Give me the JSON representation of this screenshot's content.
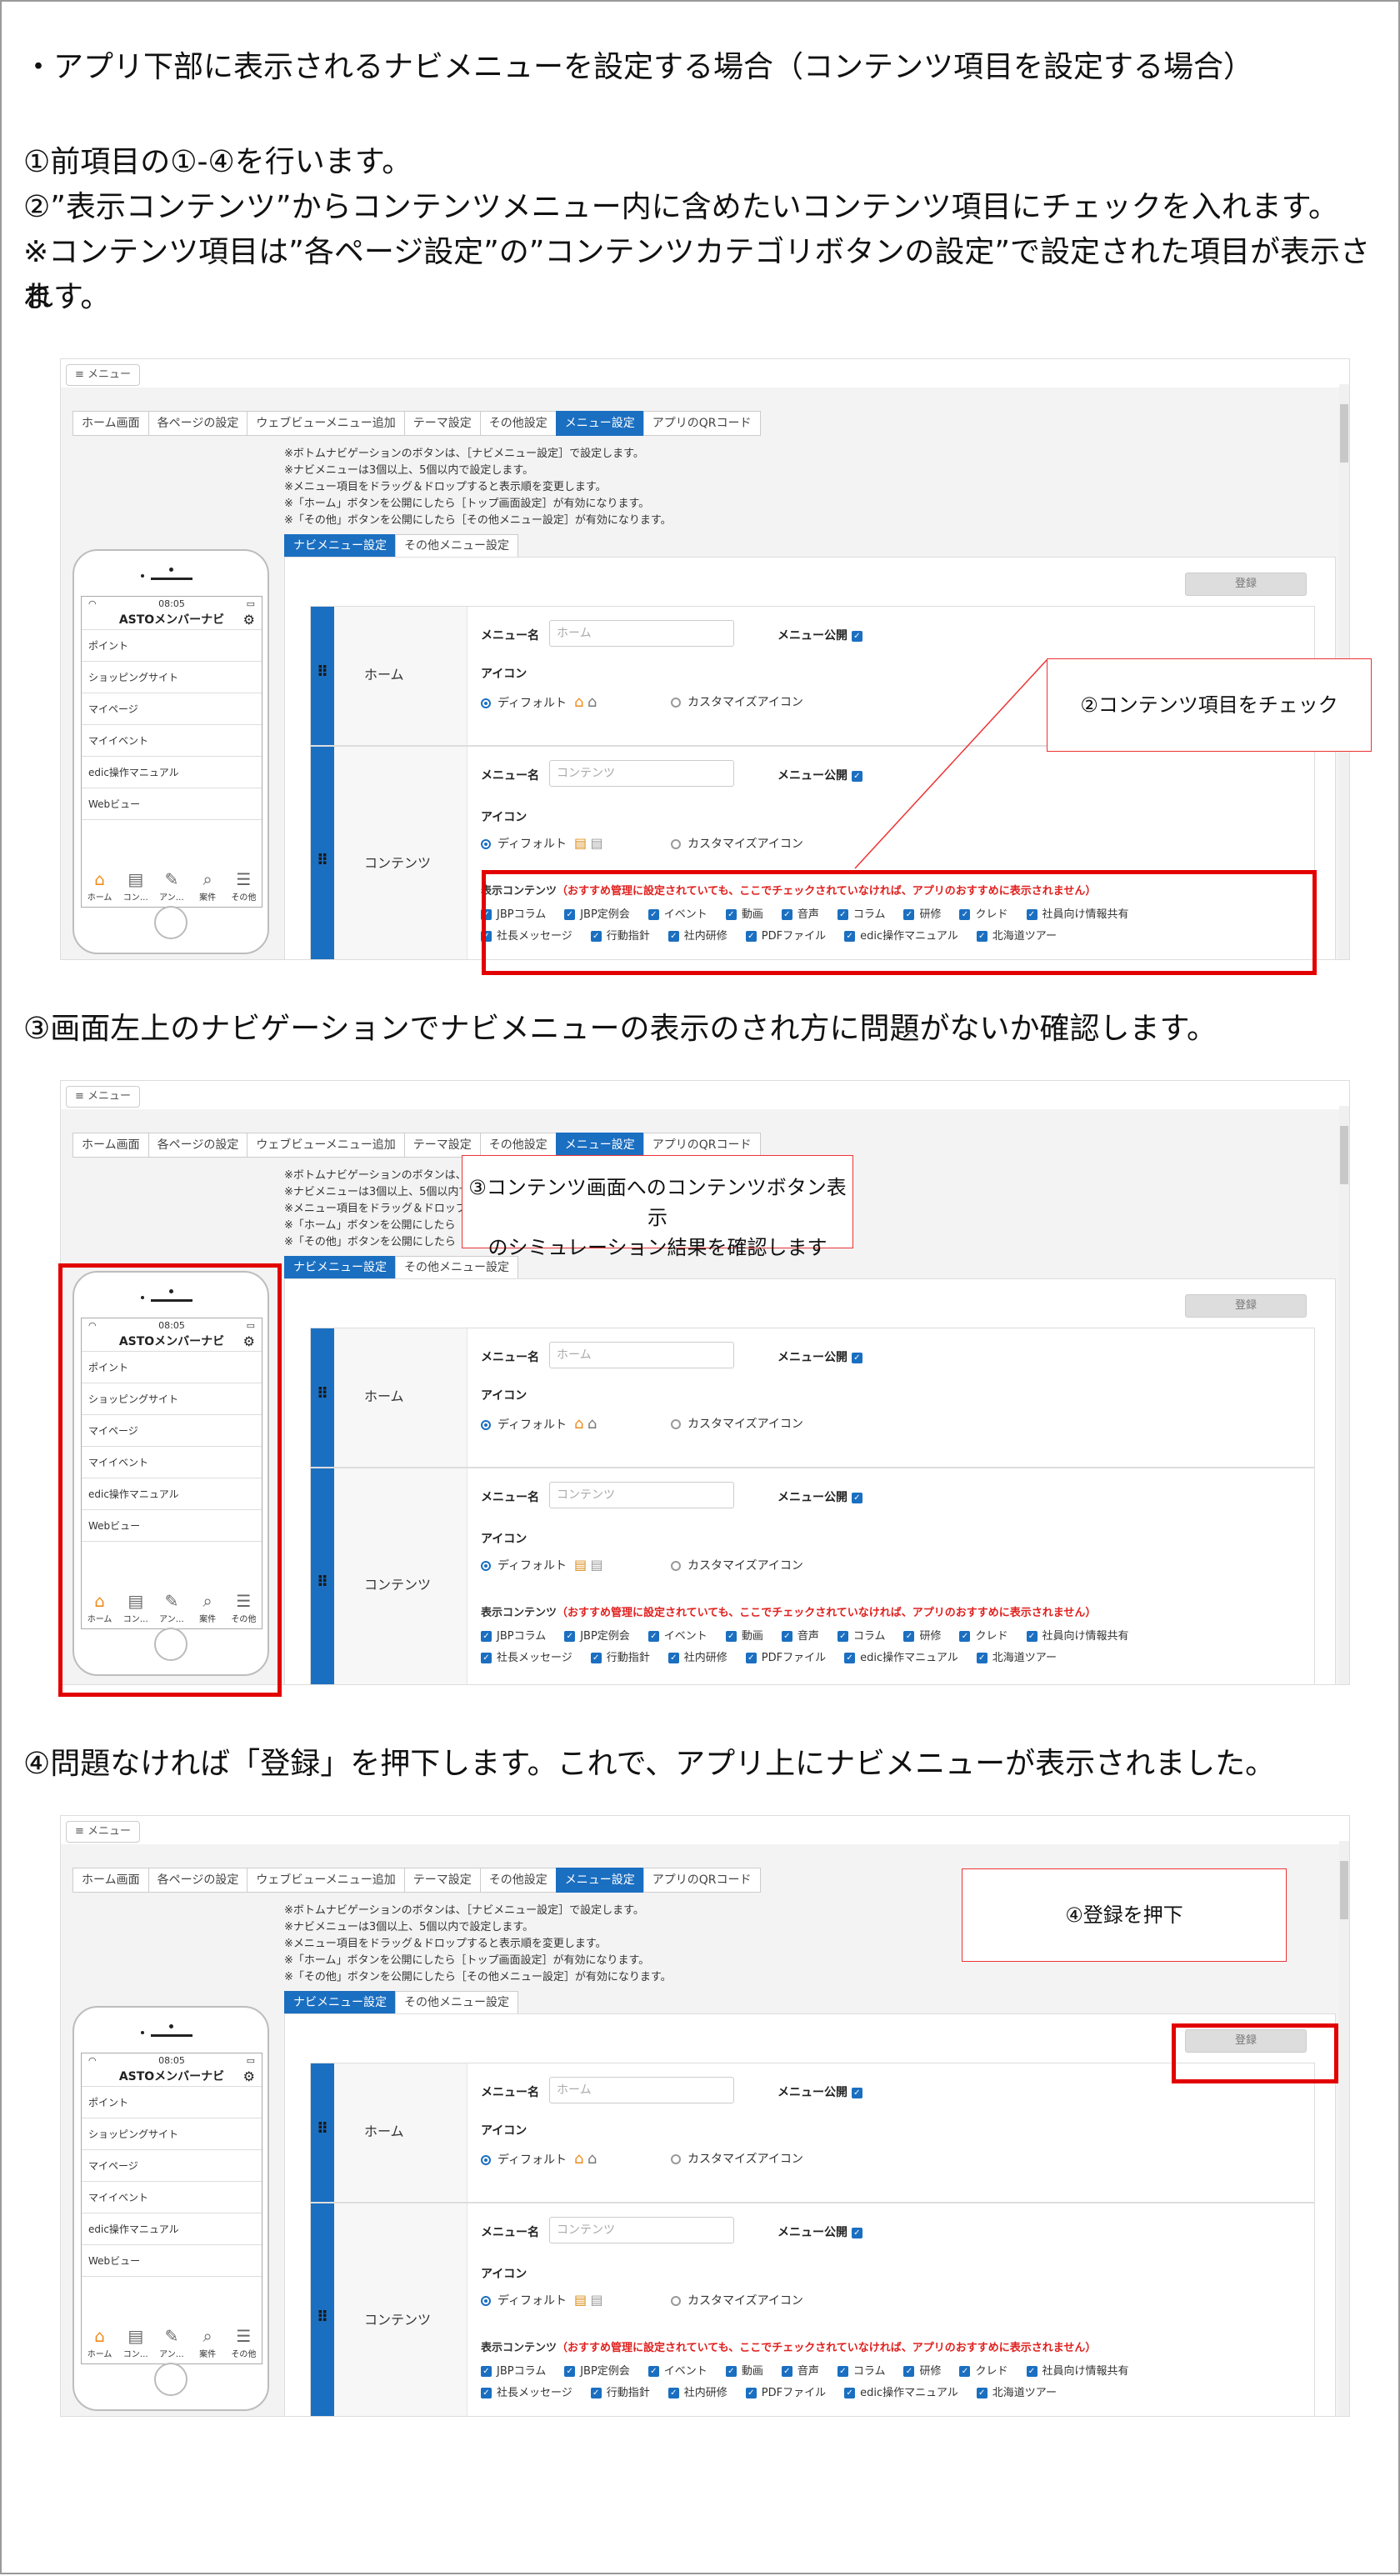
{
  "intro": {
    "line1": "・アプリ下部に表示されるナビメニューを設定する場合（コンテンツ項目を設定する場合）",
    "line2": "①前項目の①-④を行います。",
    "line3": "②”表示コンテンツ”からコンテンツメニュー内に含めたいコンテンツ項目にチェックを入れます。",
    "line4": "※コンテンツ項目は”各ページ設定”の”コンテンツカテゴリボタンの設定”で設定された項目が表示され",
    "line5": "ます。"
  },
  "step3_text": "③画面左上のナビゲーションでナビメニューの表示のされ方に問題がないか確認します。",
  "step4_text": "④問題なければ「登録」を押下します。これで、アプリ上にナビメニューが表示されました。",
  "callouts": {
    "c1": "②コンテンツ項目をチェック",
    "c2a": "③コンテンツ画面へのコンテンツボタン表示",
    "c2b": "のシミュレーション結果を確認します",
    "c3": "④登録を押下"
  },
  "ui": {
    "menu_button": "≡ メニュー",
    "tabs": [
      "ホーム画面",
      "各ページの設定",
      "ウェブビューメニュー追加",
      "テーマ設定",
      "その他設定",
      "メニュー設定",
      "アプリのQRコード"
    ],
    "notes": [
      "※ボトムナビゲーションのボタンは、［ナビメニュー設定］で設定します。",
      "※ナビメニューは3個以上、5個以内で設定します。",
      "※メニュー項目をドラッグ＆ドロップすると表示順を変更します。",
      "※「ホーム」ボタンを公開にしたら［トップ画面設定］が有効になります。",
      "※「その他」ボタンを公開にしたら［その他メニュー設定］が有効になります。"
    ],
    "subtabs": [
      "ナビメニュー設定",
      "その他メニュー設定"
    ],
    "register": "登録",
    "row1_label": "ホーム",
    "row2_label": "コンテンツ",
    "menu_name_label": "メニュー名",
    "menu_public_label": "メニュー公開",
    "row1_placeholder": "ホーム",
    "row2_placeholder": "コンテンツ",
    "icon_label": "アイコン",
    "default_label": "ディフォルト",
    "custom_icon_label": "カスタマイズアイコン",
    "display_contents_label": "表示コンテンツ",
    "display_contents_note": "（おすすめ管理に設定されていても、ここでチェックされていなければ、アプリのおすすめに表示されません）",
    "contents_row1": [
      "JBPコラム",
      "JBP定例会",
      "イベント",
      "動画",
      "音声",
      "コラム",
      "研修",
      "クレド",
      "社員向け情報共有"
    ],
    "contents_row2": [
      "社長メッセージ",
      "行動指針",
      "社内研修",
      "PDFファイル",
      "edic操作マニュアル",
      "北海道ツアー"
    ]
  },
  "phone": {
    "time": "08:05",
    "app_title": "ASTOメンバーナビ",
    "menu_items": [
      "ポイント",
      "ショッピングサイト",
      "マイページ",
      "マイイベント",
      "edic操作マニュアル",
      "Webビュー"
    ],
    "nav": [
      "ホーム",
      "コン…",
      "アン…",
      "案件",
      "その他"
    ]
  },
  "colors": {
    "accent": "#1b6fc1",
    "highlight": "#e30000",
    "warning_text": "#e0201e",
    "home_icon": "#f08a1c"
  }
}
